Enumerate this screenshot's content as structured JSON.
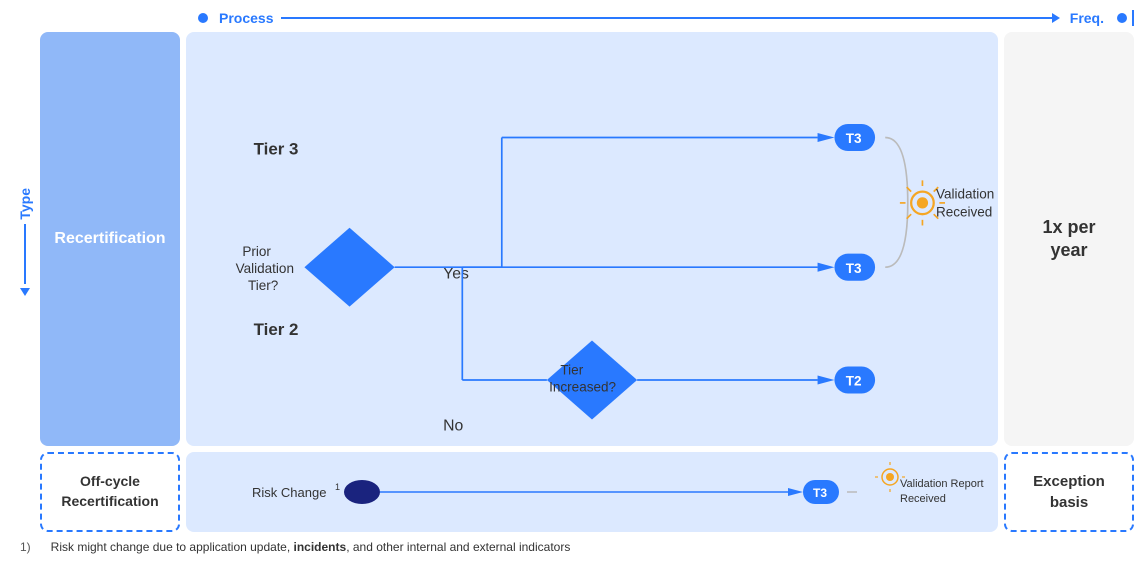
{
  "header": {
    "process_label": "Process",
    "freq_label": "Freq."
  },
  "type_label": "Type",
  "recert_label": "Recertification",
  "offcycle_label": "Off-cycle\nRecertification",
  "exception_label": "Exception\nbasis",
  "freq_value": "1x per\nyear",
  "diagram": {
    "tier3_label": "Tier 3",
    "tier2_label": "Tier 2",
    "yes_label": "Yes",
    "no_label": "No",
    "prior_validation_label": "Prior\nValidation\nTier?",
    "tier_increased_label": "Tier\nIncreased?",
    "validation_received_label": "Validation\nReceived",
    "validation_report_label": "Validation Report\nReceived",
    "risk_change_label": "Risk Change"
  },
  "footnote": {
    "number": "1)",
    "text": "Risk might change due to application update, ",
    "bold_text": "incidents",
    "text2": ", and other internal and external indicators"
  },
  "badges": {
    "t3": "T3",
    "t2": "T2"
  }
}
